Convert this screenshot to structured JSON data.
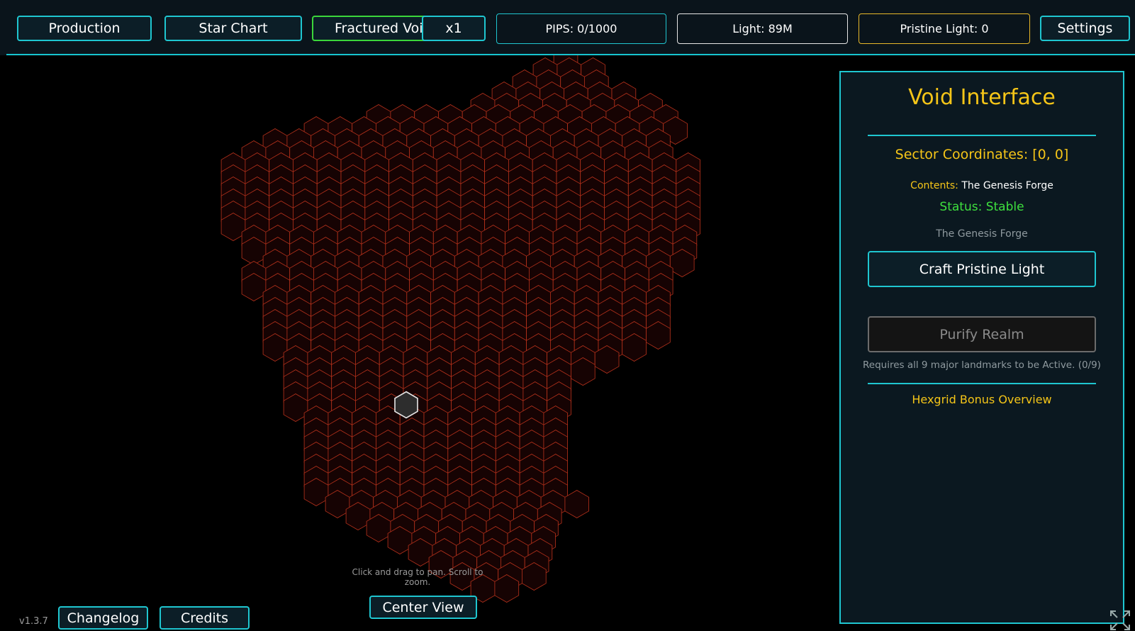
{
  "nav": {
    "production": "Production",
    "star_chart": "Star Chart",
    "fractured_void": "Fractured Void",
    "speed": "x1",
    "settings": "Settings"
  },
  "stats": {
    "pips": "PIPS: 0/1000",
    "light": "Light: 89M",
    "pristine_light": "Pristine Light: 0"
  },
  "map": {
    "hint": "Click and drag to pan. Scroll to zoom.",
    "center_view": "Center View",
    "colors": {
      "cell_stroke": "#b8321c",
      "cell_fill": "#160303",
      "selected_stroke": "#e8e8e8",
      "selected_fill": "#2d2d2d"
    }
  },
  "footer": {
    "version": "v1.3.7",
    "changelog": "Changelog",
    "credits": "Credits"
  },
  "panel": {
    "title": "Void Interface",
    "sector": "Sector Coordinates: [0, 0]",
    "contents_label": "Contents:",
    "contents_value": "The Genesis Forge",
    "status": "Status: Stable",
    "landmark": "The Genesis Forge",
    "craft_button": "Craft Pristine Light",
    "purify_button": "Purify Realm",
    "requires": "Requires all 9 major landmarks to be Active. (0/9)",
    "hexgrid_bonus": "Hexgrid Bonus Overview"
  },
  "colors": {
    "accent": "#1fc6d0",
    "gold": "#f5c518",
    "green": "#3ee03e"
  }
}
